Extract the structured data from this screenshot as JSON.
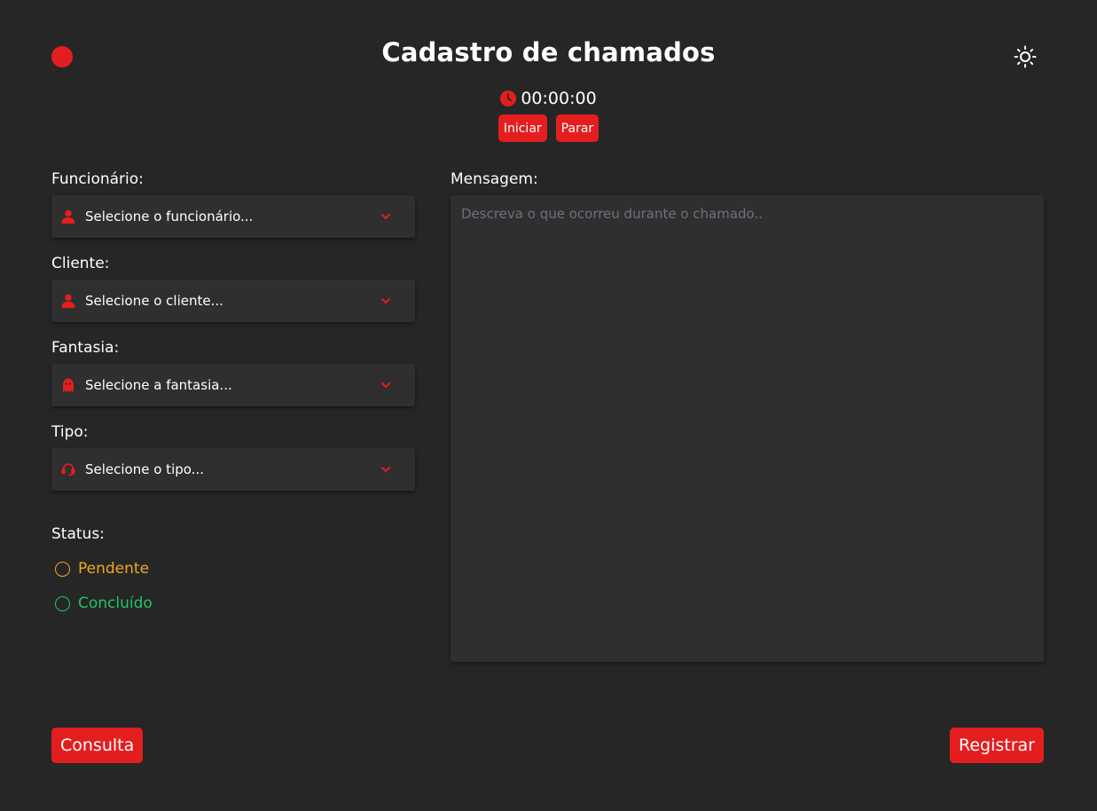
{
  "header": {
    "title": "Cadastro de chamados",
    "record_icon": "record-dot-icon",
    "theme_icon": "sun-icon"
  },
  "timer": {
    "icon": "clock-icon",
    "value": "00:00:00",
    "start_label": "Iniciar",
    "stop_label": "Parar"
  },
  "form": {
    "employee": {
      "label": "Funcionário:",
      "placeholder": "Selecione o funcionário...",
      "icon": "user-icon"
    },
    "client": {
      "label": "Cliente:",
      "placeholder": "Selecione o cliente...",
      "icon": "user-icon"
    },
    "fantasy": {
      "label": "Fantasia:",
      "placeholder": "Selecione a fantasia...",
      "icon": "ghost-icon"
    },
    "type": {
      "label": "Tipo:",
      "placeholder": "Selecione o tipo...",
      "icon": "headset-icon"
    },
    "status": {
      "label": "Status:",
      "options": [
        {
          "label": "Pendente",
          "color": "#f0a81e"
        },
        {
          "label": "Concluído",
          "color": "#22c55e"
        }
      ]
    },
    "message": {
      "label": "Mensagem:",
      "placeholder": "Descreva o que ocorreu durante o chamado.."
    }
  },
  "footer": {
    "query_label": "Consulta",
    "register_label": "Registrar"
  },
  "colors": {
    "accent": "#e41e1e",
    "background": "#262626",
    "surface": "#2f2f2f",
    "pending": "#f0a81e",
    "done": "#22c55e"
  }
}
